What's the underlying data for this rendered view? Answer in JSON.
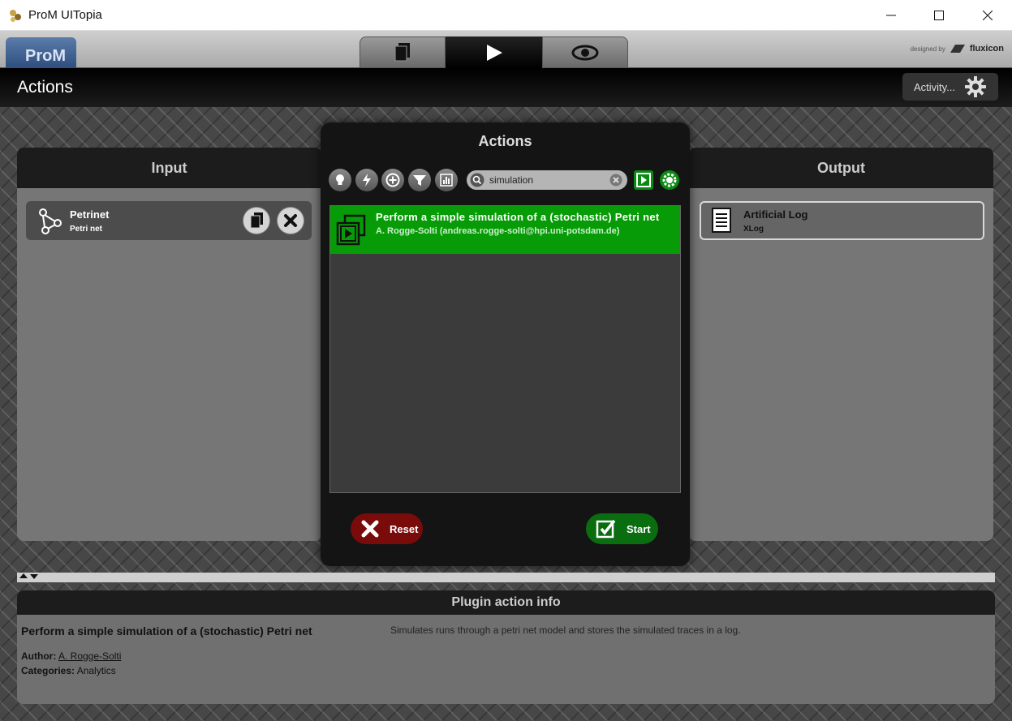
{
  "window": {
    "title": "ProM UITopia"
  },
  "topbar": {
    "logo_text": "ProM",
    "tabs": [
      {
        "icon": "workspace-icon"
      },
      {
        "icon": "play-icon",
        "active": true
      },
      {
        "icon": "eye-icon"
      }
    ],
    "designed_by": "designed by",
    "brand": "fluxicon"
  },
  "header": {
    "title": "Actions",
    "activity_label": "Activity..."
  },
  "input_panel": {
    "title": "Input",
    "items": [
      {
        "name": "Petrinet",
        "type": "Petri net"
      }
    ]
  },
  "output_panel": {
    "title": "Output",
    "items": [
      {
        "name": "Artificial Log",
        "type": "XLog"
      }
    ]
  },
  "actions_dialog": {
    "title": "Actions",
    "search": {
      "value": "simulation",
      "placeholder": ""
    },
    "results": [
      {
        "title": "Perform a simple simulation of a (stochastic) Petri net",
        "author": "A. Rogge-Solti (andreas.rogge-solti@hpi.uni-potsdam.de)",
        "selected": true
      }
    ],
    "reset_label": "Reset",
    "start_label": "Start"
  },
  "plugin_info": {
    "title": "Plugin action info",
    "plugin_name": "Perform a simple simulation of a (stochastic) Petri net",
    "author_label": "Author:",
    "author": "A. Rogge-Solti",
    "categories_label": "Categories:",
    "categories": "Analytics",
    "description": "Simulates runs through a petri net model and stores the simulated traces in a log."
  },
  "colors": {
    "accent_green": "#079c07",
    "reset_red": "#7a0b0b",
    "start_green": "#0a6d10"
  }
}
